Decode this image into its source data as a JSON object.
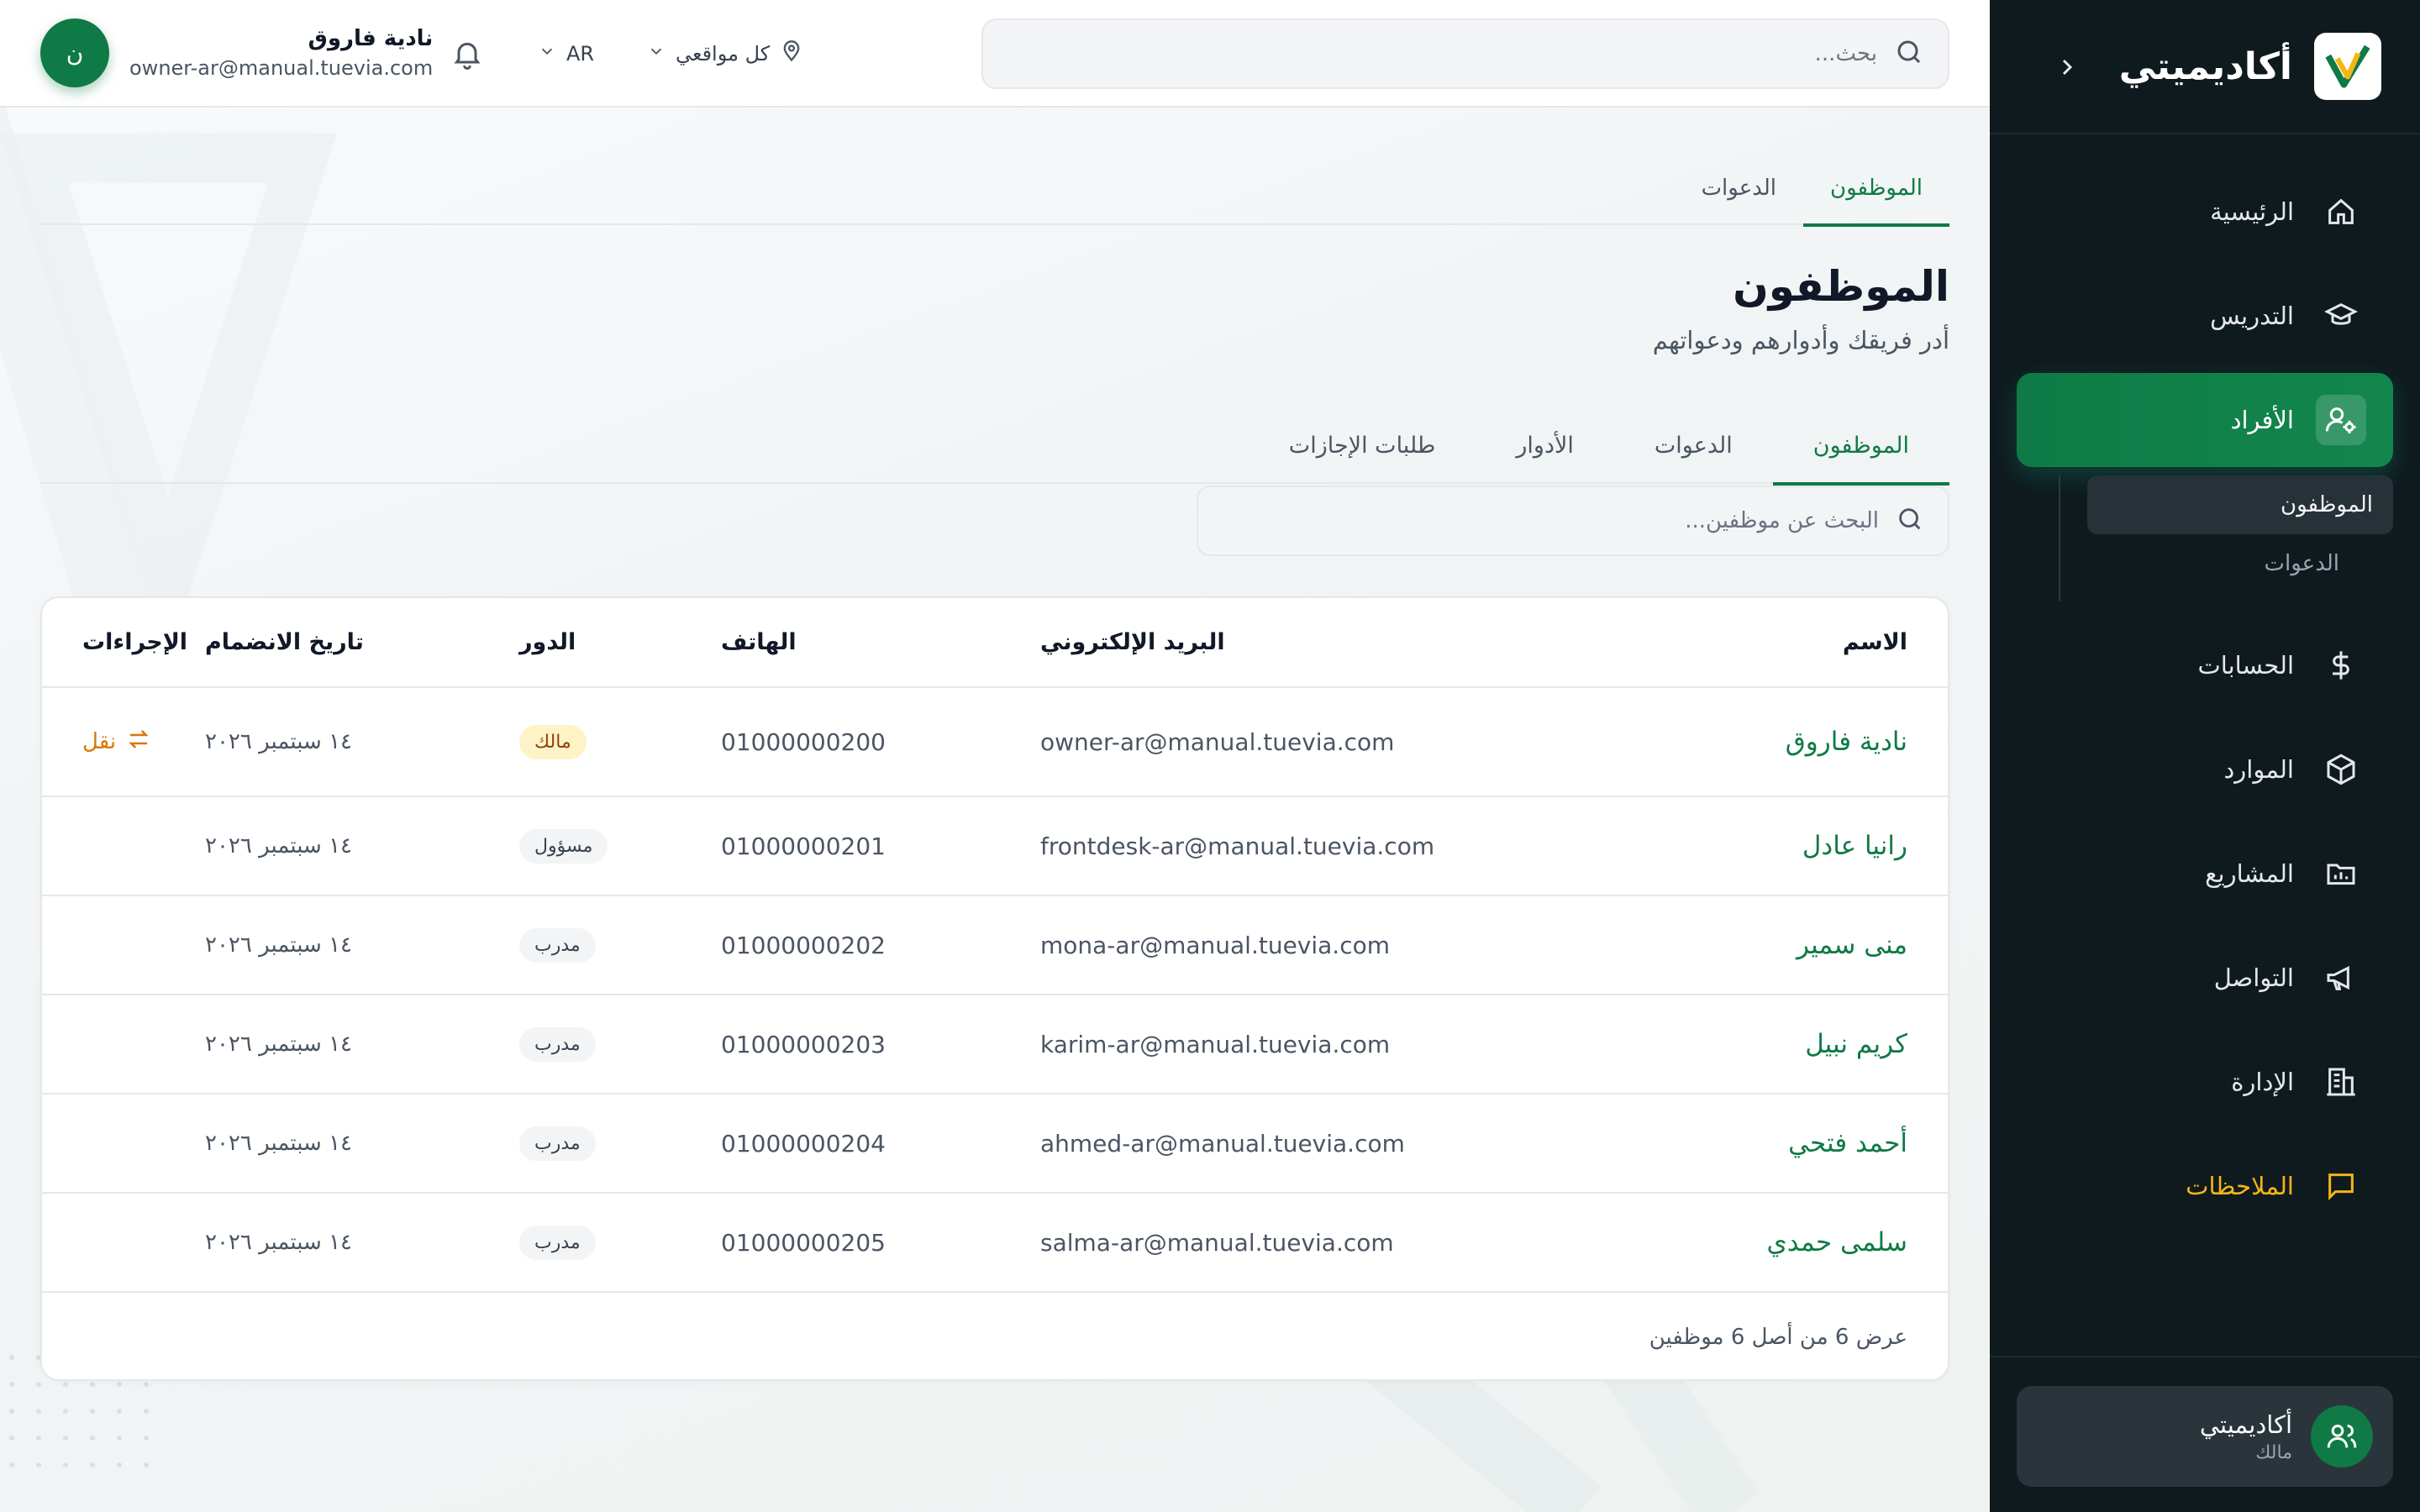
{
  "brand": {
    "name": "أكاديميتي"
  },
  "sidebar": {
    "items": [
      {
        "label": "الرئيسية",
        "icon": "home-icon"
      },
      {
        "label": "التدريس",
        "icon": "graduation-cap-icon"
      },
      {
        "label": "الأفراد",
        "icon": "user-gear-icon",
        "active": true
      },
      {
        "label": "الحسابات",
        "icon": "dollar-icon"
      },
      {
        "label": "الموارد",
        "icon": "box-icon"
      },
      {
        "label": "المشاريع",
        "icon": "folder-chart-icon"
      },
      {
        "label": "التواصل",
        "icon": "megaphone-icon"
      },
      {
        "label": "الإدارة",
        "icon": "building-icon"
      },
      {
        "label": "الملاحظات",
        "icon": "message-icon",
        "highlight": "#f5b614"
      }
    ],
    "subitems": [
      {
        "label": "الموظفون",
        "active": true
      },
      {
        "label": "الدعوات"
      }
    ],
    "account": {
      "name": "أكاديميتي",
      "role": "مالك"
    }
  },
  "topbar": {
    "search_placeholder": "بحث...",
    "location": "كل مواقعي",
    "language": "AR",
    "user": {
      "initial": "ن",
      "name": "نادية فاروق",
      "email": "owner-ar@manual.tuevia.com"
    }
  },
  "tabs_top": [
    "الموظفون",
    "الدعوات"
  ],
  "page": {
    "title": "الموظفون",
    "subtitle": "أدر فريقك وأدوارهم ودعواتهم"
  },
  "tabs_secondary": [
    "الموظفون",
    "الدعوات",
    "الأدوار",
    "طلبات الإجازات"
  ],
  "employee_search_placeholder": "البحث عن موظفين...",
  "table": {
    "headers": {
      "name": "الاسم",
      "email": "البريد الإلكتروني",
      "phone": "الهاتف",
      "role": "الدور",
      "joined": "تاريخ الانضمام",
      "actions": "الإجراءات"
    },
    "rows": [
      {
        "name": "نادية فاروق",
        "email": "owner-ar@manual.tuevia.com",
        "phone": "01000000200",
        "role": "مالك",
        "joined": "١٤ سبتمبر ٢٠٢٦",
        "action": "نقل"
      },
      {
        "name": "رانيا عادل",
        "email": "frontdesk-ar@manual.tuevia.com",
        "phone": "01000000201",
        "role": "مسؤول",
        "joined": "١٤ سبتمبر ٢٠٢٦",
        "action": ""
      },
      {
        "name": "منى سمير",
        "email": "mona-ar@manual.tuevia.com",
        "phone": "01000000202",
        "role": "مدرب",
        "joined": "١٤ سبتمبر ٢٠٢٦",
        "action": ""
      },
      {
        "name": "كريم نبيل",
        "email": "karim-ar@manual.tuevia.com",
        "phone": "01000000203",
        "role": "مدرب",
        "joined": "١٤ سبتمبر ٢٠٢٦",
        "action": ""
      },
      {
        "name": "أحمد فتحي",
        "email": "ahmed-ar@manual.tuevia.com",
        "phone": "01000000204",
        "role": "مدرب",
        "joined": "١٤ سبتمبر ٢٠٢٦",
        "action": ""
      },
      {
        "name": "سلمى حمدي",
        "email": "salma-ar@manual.tuevia.com",
        "phone": "01000000205",
        "role": "مدرب",
        "joined": "١٤ سبتمبر ٢٠٢٦",
        "action": ""
      }
    ],
    "footer": "عرض 6 من أصل 6 موظفين"
  },
  "colors": {
    "accent": "#0f7a45",
    "sidebar_bg": "#0f1a1f",
    "highlight": "#f5b614",
    "owner_badge_bg": "#fef3c7"
  }
}
